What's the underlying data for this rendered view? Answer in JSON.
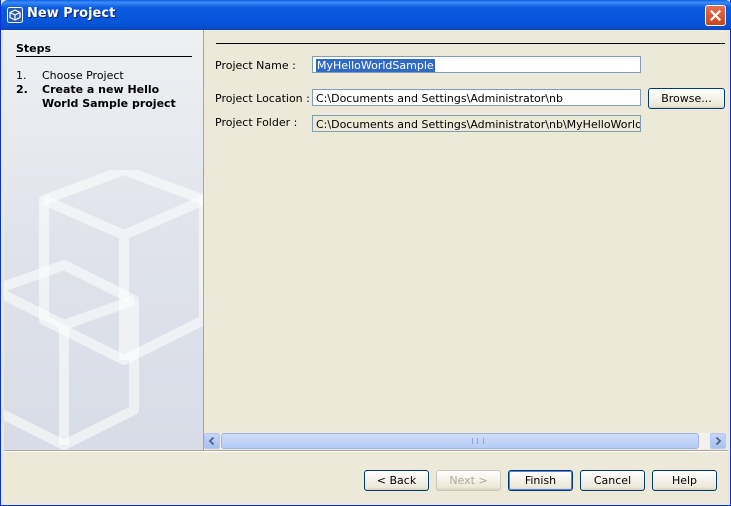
{
  "window": {
    "title": "New Project"
  },
  "steps": {
    "heading": "Steps",
    "items": [
      {
        "number": "1.",
        "label": "Choose Project",
        "current": false
      },
      {
        "number": "2.",
        "label": "Create a new Hello World Sample project",
        "current": true
      }
    ]
  },
  "form": {
    "project_name_label": "Project Name :",
    "project_name_value": "MyHelloWorldSample",
    "project_location_label": "Project Location :",
    "project_location_value": "C:\\Documents and Settings\\Administrator\\nb",
    "browse_label": "Browse...",
    "project_folder_label": "Project Folder :",
    "project_folder_value": "C:\\Documents and Settings\\Administrator\\nb\\MyHelloWorldSample"
  },
  "buttons": {
    "back": "< Back",
    "next": "Next >",
    "finish": "Finish",
    "cancel": "Cancel",
    "help": "Help"
  },
  "colors": {
    "titlebar": "#0754d8",
    "selection": "#316ac5",
    "dialog_bg": "#ece9d8"
  }
}
